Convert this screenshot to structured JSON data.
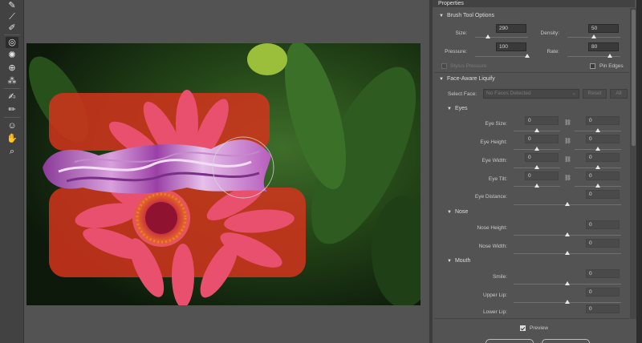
{
  "panel": {
    "title": "Properties"
  },
  "brush_tool_options": {
    "title": "Brush Tool Options",
    "size_label": "Size:",
    "size_value": "290",
    "size_level": 0.29,
    "density_label": "Density:",
    "density_value": "50",
    "density_level": 0.5,
    "pressure_label": "Pressure:",
    "pressure_value": "100",
    "pressure_level": 1.0,
    "rate_label": "Rate:",
    "rate_value": "80",
    "rate_level": 0.8,
    "stylus_pressure_label": "Stylus Pressure",
    "pin_edges_label": "Pin Edges"
  },
  "face_aware": {
    "title": "Face-Aware Liquify",
    "select_face_label": "Select Face:",
    "select_face_value": "No Faces Detected",
    "reset_label": "Reset",
    "all_label": "All"
  },
  "eyes": {
    "title": "Eyes",
    "eye_size_label": "Eye Size:",
    "eye_height_label": "Eye Height:",
    "eye_width_label": "Eye Width:",
    "eye_tilt_label": "Eye Tilt:",
    "eye_distance_label": "Eye Distance:",
    "zero": "0"
  },
  "nose": {
    "title": "Nose",
    "nose_height_label": "Nose Height:",
    "nose_width_label": "Nose Width:",
    "zero": "0"
  },
  "mouth": {
    "title": "Mouth",
    "smile_label": "Smile:",
    "upper_lip_label": "Upper Lip:",
    "lower_lip_label": "Lower Lip:",
    "zero": "0"
  },
  "preview": {
    "label": "Preview"
  },
  "colors": {
    "accent_red": "#d4341c",
    "petal_pink": "#e8506e",
    "swirl_purple": "#a24aa8"
  },
  "tools": [
    "forward-warp-icon",
    "reconstruct-icon",
    "smooth-icon",
    "twirl-icon",
    "pucker-icon",
    "bloat-icon",
    "push-left-icon",
    "freeze-mask-icon",
    "thaw-mask-icon",
    "face-tool-icon",
    "hand-icon",
    "zoom-icon"
  ]
}
